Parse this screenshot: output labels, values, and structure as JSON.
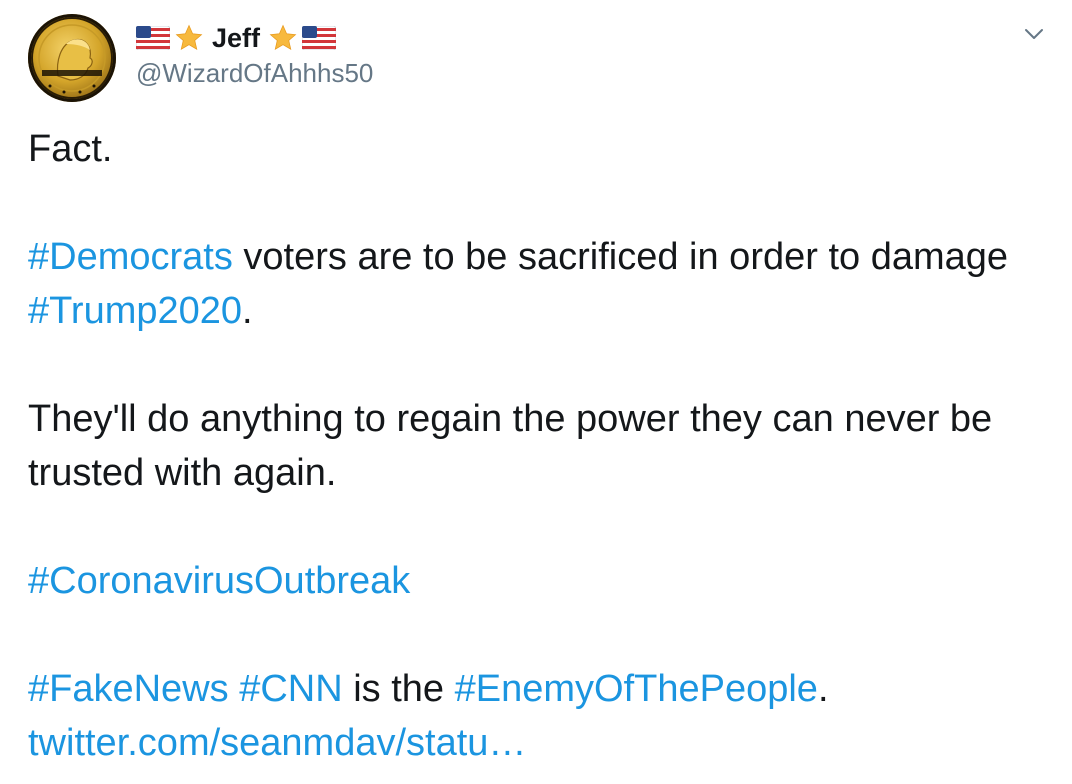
{
  "author": {
    "display_name": "Jeff",
    "handle": "@WizardOfAhhhs50",
    "name_prefix_icons": [
      "us-flag-icon",
      "star-icon"
    ],
    "name_suffix_icons": [
      "star-icon",
      "us-flag-icon"
    ]
  },
  "tweet": {
    "line1": "Fact.",
    "p2": {
      "tag1": "#Democrats",
      "text1": " voters are to be sacrificed in order to damage ",
      "tag2": "#Trump2020",
      "text2": "."
    },
    "p3": "They'll do anything to regain the power they can never be trusted with again.",
    "p4": {
      "tag1": "#CoronavirusOutbreak"
    },
    "p5": {
      "tag1": "#FakeNews",
      "space1": " ",
      "tag2": "#CNN",
      "text1": " is the ",
      "tag3": "#EnemyOfThePeople",
      "text2": "."
    },
    "link": "twitter.com/seanmdav/statu…"
  },
  "colors": {
    "text": "#14171a",
    "secondary": "#657786",
    "link": "#1b95e0",
    "star": "#f7b93e"
  }
}
